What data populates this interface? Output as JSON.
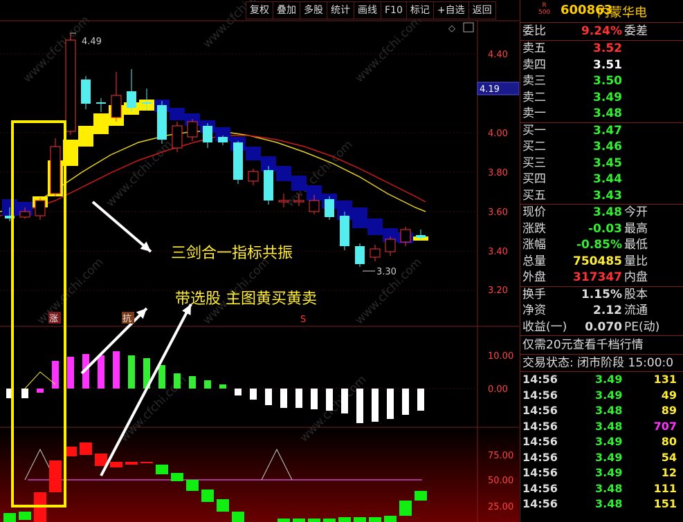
{
  "toolbar": [
    "复权",
    "叠加",
    "多股",
    "统计",
    "画线",
    "F10",
    "标记",
    "+自选",
    "返回"
  ],
  "header": {
    "badge_top": "R",
    "badge_bottom": "500",
    "code": "600863",
    "name": "内蒙华电"
  },
  "chart": {
    "price_axis": [
      "4.40",
      "4.19",
      "4.00",
      "3.80",
      "3.60",
      "3.40",
      "3.20"
    ],
    "current_price_tag": "4.19",
    "high_marker": "4.49",
    "low_marker": "3.30",
    "macd_axis": [
      "10.00",
      "0.00"
    ],
    "kd_axis": [
      "75.00",
      "50.00",
      "25.00"
    ],
    "annotation_1": "三剑合一指标共振",
    "annotation_2": "带选股  主图黄买黄卖",
    "badge_up": "涨",
    "badge_other": "抗",
    "badge_s": "S",
    "watermark": "www.cfchi.com"
  },
  "quote": {
    "webi": {
      "label": "委比",
      "value": "9.24%",
      "label2": "委差"
    },
    "asks": [
      {
        "label": "卖五",
        "price": "3.52",
        "color": "#ff3333"
      },
      {
        "label": "卖四",
        "price": "3.51",
        "color": "#ffffff"
      },
      {
        "label": "卖三",
        "price": "3.50",
        "color": "#33ee33"
      },
      {
        "label": "卖二",
        "price": "3.49",
        "color": "#33ee33"
      },
      {
        "label": "卖一",
        "price": "3.48",
        "color": "#33ee33"
      }
    ],
    "bids": [
      {
        "label": "买一",
        "price": "3.47",
        "color": "#33ee33"
      },
      {
        "label": "买二",
        "price": "3.46",
        "color": "#33ee33"
      },
      {
        "label": "买三",
        "price": "3.45",
        "color": "#33ee33"
      },
      {
        "label": "买四",
        "price": "3.44",
        "color": "#33ee33"
      },
      {
        "label": "买五",
        "price": "3.43",
        "color": "#33ee33"
      }
    ],
    "stats1": [
      {
        "label": "现价",
        "value": "3.48",
        "color": "#33ee33",
        "label2": "今开"
      },
      {
        "label": "涨跌",
        "value": "-0.03",
        "color": "#33ee33",
        "label2": "最高"
      },
      {
        "label": "涨幅",
        "value": "-0.85%",
        "color": "#33ee33",
        "label2": "最低"
      },
      {
        "label": "总量",
        "value": "750485",
        "color": "#ffee33",
        "label2": "量比"
      },
      {
        "label": "外盘",
        "value": "317347",
        "color": "#ff3333",
        "label2": "内盘"
      }
    ],
    "stats2": [
      {
        "label": "换手",
        "value": "1.15%",
        "color": "#dddddd",
        "label2": "股本"
      },
      {
        "label": "净资",
        "value": "2.12",
        "color": "#dddddd",
        "label2": "流通"
      },
      {
        "label": "收益(一)",
        "value": "0.070",
        "color": "#dddddd",
        "label2": "PE(动)"
      }
    ],
    "promo": "仅需20元查看千档行情",
    "state": "交易状态: 闭市阶段  15:00:0",
    "ticks": [
      {
        "time": "14:56",
        "price": "3.49",
        "vol": "131",
        "vcolor": "#ffee33"
      },
      {
        "time": "14:56",
        "price": "3.49",
        "vol": "49",
        "vcolor": "#ffee33"
      },
      {
        "time": "14:56",
        "price": "3.48",
        "vol": "89",
        "vcolor": "#ffee33"
      },
      {
        "time": "14:56",
        "price": "3.48",
        "vol": "707",
        "vcolor": "#ff33ff"
      },
      {
        "time": "14:56",
        "price": "3.49",
        "vol": "80",
        "vcolor": "#ffee33"
      },
      {
        "time": "14:56",
        "price": "3.49",
        "vol": "54",
        "vcolor": "#ffee33"
      },
      {
        "time": "14:56",
        "price": "3.49",
        "vol": "12",
        "vcolor": "#ffee33"
      },
      {
        "time": "14:56",
        "price": "3.48",
        "vol": "111",
        "vcolor": "#ffee33"
      },
      {
        "time": "14:56",
        "price": "3.48",
        "vol": "151",
        "vcolor": "#ffee33"
      }
    ]
  }
}
